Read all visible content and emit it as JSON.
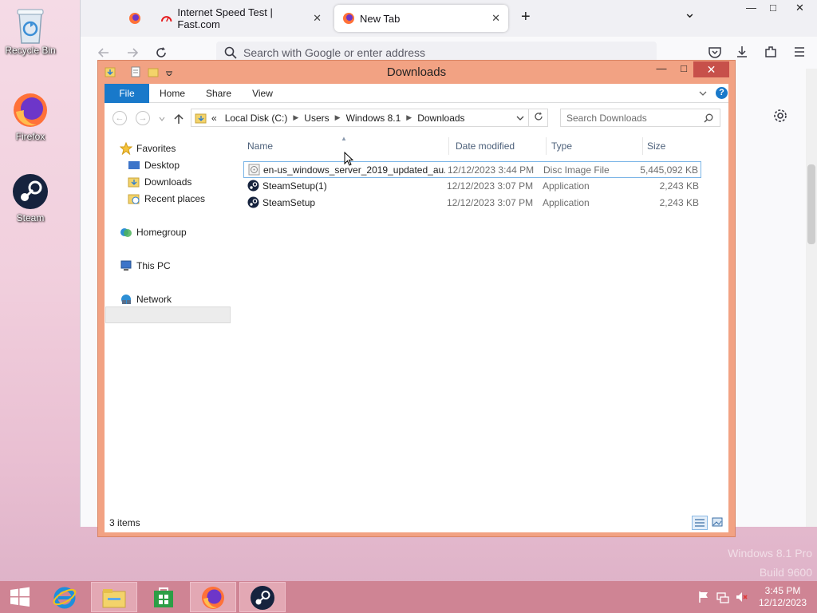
{
  "desktop": {
    "icons": [
      {
        "label": "Recycle Bin"
      },
      {
        "label": "Firefox"
      },
      {
        "label": "Steam"
      }
    ]
  },
  "browser": {
    "tabs": [
      {
        "label": ""
      },
      {
        "label": "Internet Speed Test | Fast.com"
      },
      {
        "label": "New Tab"
      }
    ],
    "close_glyph": "✕",
    "new_tab_glyph": "+",
    "tab_list_glyph": "⌄",
    "window_controls": {
      "minimize": "—",
      "maximize": "□",
      "close": "✕"
    },
    "url_placeholder": "Search with Google or enter address"
  },
  "explorer": {
    "title": "Downloads",
    "window_controls": {
      "minimize": "—",
      "maximize": "□",
      "close": "✕"
    },
    "ribbon_tabs": [
      "File",
      "Home",
      "Share",
      "View"
    ],
    "help_glyph": "?",
    "address": {
      "prefix": "«",
      "crumbs": [
        "Local Disk (C:)",
        "Users",
        "Windows 8.1",
        "Downloads"
      ]
    },
    "search_placeholder": "Search Downloads",
    "nav": {
      "favorites": "Favorites",
      "desktop": "Desktop",
      "downloads": "Downloads",
      "recent": "Recent places",
      "homegroup": "Homegroup",
      "thispc": "This PC",
      "network": "Network"
    },
    "columns": [
      "Name",
      "Date modified",
      "Type",
      "Size"
    ],
    "files": [
      {
        "name": "en-us_windows_server_2019_updated_au...",
        "date": "12/12/2023 3:44 PM",
        "type": "Disc Image File",
        "size": "5,445,092 KB",
        "icon": "disc-image-icon"
      },
      {
        "name": "SteamSetup(1)",
        "date": "12/12/2023 3:07 PM",
        "type": "Application",
        "size": "2,243 KB",
        "icon": "steam-icon"
      },
      {
        "name": "SteamSetup",
        "date": "12/12/2023 3:07 PM",
        "type": "Application",
        "size": "2,243 KB",
        "icon": "steam-icon"
      }
    ],
    "status": "3 items"
  },
  "watermark": {
    "line1": "Windows 8.1 Pro",
    "line2": "Build 9600"
  },
  "taskbar": {
    "time": "3:45 PM",
    "date": "12/12/2023"
  },
  "colors": {
    "window_frame": "#f2a283",
    "accent_blue": "#1979ca",
    "taskbar": "#cf8494"
  }
}
